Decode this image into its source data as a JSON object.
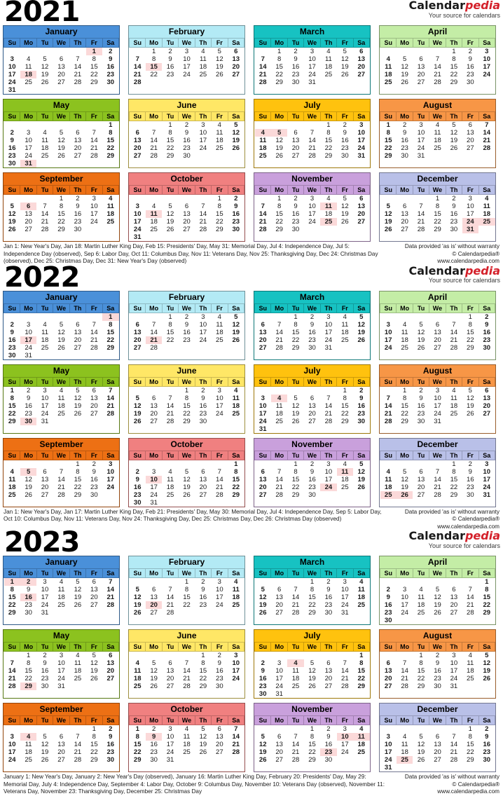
{
  "brand": {
    "name_part1": "Calendar",
    "name_part2": "pedia",
    "tagline": "Your source for calendars"
  },
  "disclaimer": {
    "line1": "Data provided 'as is' without warranty",
    "line2": "© Calendarpedia®",
    "line3": "www.calendarpedia.com"
  },
  "weekday_headers": [
    "Su",
    "Mo",
    "Tu",
    "We",
    "Th",
    "Fr",
    "Sa"
  ],
  "month_colors": {
    "January": "#4a90d9",
    "February": "#b3eaf5",
    "March": "#17c2c2",
    "April": "#c4eda6",
    "May": "#8cc21f",
    "June": "#ffe766",
    "July": "#ffc20e",
    "August": "#f79646",
    "September": "#ed7014",
    "October": "#f08080",
    "November": "#c9a0dc",
    "December": "#b9c0e8"
  },
  "years": [
    {
      "year": "2021",
      "holidays": "Jan 1: New Year's Day, Jan 18: Martin Luther King Day, Feb 15: Presidents' Day, May 31: Memorial Day, Jul 4: Independence Day, Jul 5: Independence Day (observed), Sep 6: Labor Day, Oct 11: Columbus Day, Nov 11: Veterans Day, Nov 25: Thanksgiving Day, Dec 24: Christmas Day (observed), Dec 25: Christmas Day, Dec 31: New Year's Day (observed)",
      "months": [
        {
          "name": "January",
          "start": 5,
          "days": 31,
          "highlights": [
            1,
            18
          ]
        },
        {
          "name": "February",
          "start": 1,
          "days": 28,
          "highlights": [
            15
          ]
        },
        {
          "name": "March",
          "start": 1,
          "days": 31,
          "highlights": []
        },
        {
          "name": "April",
          "start": 4,
          "days": 30,
          "highlights": []
        },
        {
          "name": "May",
          "start": 6,
          "days": 31,
          "highlights": [
            31
          ]
        },
        {
          "name": "June",
          "start": 2,
          "days": 30,
          "highlights": []
        },
        {
          "name": "July",
          "start": 4,
          "days": 31,
          "highlights": [
            4,
            5
          ]
        },
        {
          "name": "August",
          "start": 0,
          "days": 31,
          "highlights": []
        },
        {
          "name": "September",
          "start": 3,
          "days": 30,
          "highlights": [
            6
          ]
        },
        {
          "name": "October",
          "start": 5,
          "days": 31,
          "highlights": [
            11
          ]
        },
        {
          "name": "November",
          "start": 1,
          "days": 30,
          "highlights": [
            11,
            25
          ]
        },
        {
          "name": "December",
          "start": 3,
          "days": 31,
          "highlights": [
            24,
            25,
            31
          ]
        }
      ]
    },
    {
      "year": "2022",
      "holidays": "Jan 1: New Year's Day, Jan 17: Martin Luther King Day, Feb 21: Presidents' Day, May 30: Memorial Day, Jul 4: Independence Day, Sep 5: Labor Day, Oct 10: Columbus Day, Nov 11: Veterans Day, Nov 24: Thanksgiving Day, Dec 25: Christmas Day, Dec 26: Christmas Day (observed)",
      "months": [
        {
          "name": "January",
          "start": 6,
          "days": 31,
          "highlights": [
            1,
            17
          ]
        },
        {
          "name": "February",
          "start": 2,
          "days": 28,
          "highlights": [
            21
          ]
        },
        {
          "name": "March",
          "start": 2,
          "days": 31,
          "highlights": []
        },
        {
          "name": "April",
          "start": 5,
          "days": 30,
          "highlights": []
        },
        {
          "name": "May",
          "start": 0,
          "days": 31,
          "highlights": [
            30
          ]
        },
        {
          "name": "June",
          "start": 3,
          "days": 30,
          "highlights": []
        },
        {
          "name": "July",
          "start": 5,
          "days": 31,
          "highlights": [
            4
          ]
        },
        {
          "name": "August",
          "start": 1,
          "days": 31,
          "highlights": []
        },
        {
          "name": "September",
          "start": 4,
          "days": 30,
          "highlights": [
            5
          ]
        },
        {
          "name": "October",
          "start": 6,
          "days": 31,
          "highlights": [
            10
          ]
        },
        {
          "name": "November",
          "start": 2,
          "days": 30,
          "highlights": [
            11,
            24
          ]
        },
        {
          "name": "December",
          "start": 4,
          "days": 31,
          "highlights": [
            25,
            26
          ]
        }
      ]
    },
    {
      "year": "2023",
      "holidays": "January 1: New Year's Day, January 2: New Year's Day (observed), January 16: Martin Luther King Day, February 20: Presidents' Day, May 29: Memorial Day, July 4: Independence Day, September 4: Labor Day, October 9: Columbus Day, November 10: Veterans Day (observed), November 11: Veterans Day, November 23: Thanksgiving Day, December 25: Christmas Day",
      "months": [
        {
          "name": "January",
          "start": 0,
          "days": 31,
          "highlights": [
            1,
            2,
            16
          ]
        },
        {
          "name": "February",
          "start": 3,
          "days": 28,
          "highlights": [
            20
          ]
        },
        {
          "name": "March",
          "start": 3,
          "days": 31,
          "highlights": []
        },
        {
          "name": "April",
          "start": 6,
          "days": 30,
          "highlights": []
        },
        {
          "name": "May",
          "start": 1,
          "days": 31,
          "highlights": [
            29
          ]
        },
        {
          "name": "June",
          "start": 4,
          "days": 30,
          "highlights": []
        },
        {
          "name": "July",
          "start": 6,
          "days": 31,
          "highlights": [
            4
          ]
        },
        {
          "name": "August",
          "start": 2,
          "days": 31,
          "highlights": []
        },
        {
          "name": "September",
          "start": 5,
          "days": 30,
          "highlights": [
            4
          ]
        },
        {
          "name": "October",
          "start": 0,
          "days": 31,
          "highlights": [
            9
          ]
        },
        {
          "name": "November",
          "start": 3,
          "days": 30,
          "highlights": [
            10,
            11,
            23
          ]
        },
        {
          "name": "December",
          "start": 5,
          "days": 31,
          "highlights": [
            25
          ]
        }
      ]
    }
  ]
}
